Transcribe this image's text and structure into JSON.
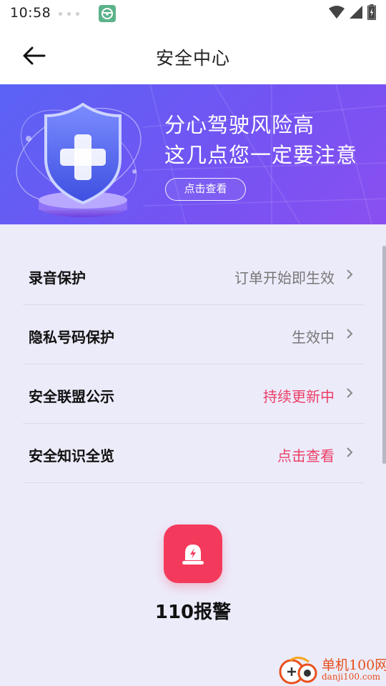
{
  "status_bar": {
    "time": "10:58",
    "icons": [
      "wifi-icon",
      "signal-icon",
      "battery-icon"
    ]
  },
  "header": {
    "title": "安全中心",
    "back_icon": "arrow-left-icon"
  },
  "banner": {
    "line1": "分心驾驶风险高",
    "line2": "这几点您一定要注意",
    "button_label": "点击查看",
    "colors": {
      "start": "#5a63f5",
      "end": "#8a4ff0"
    }
  },
  "list": {
    "items": [
      {
        "label": "录音保护",
        "value": "订单开始即生效",
        "accent": false
      },
      {
        "label": "隐私号码保护",
        "value": "生效中",
        "accent": false
      },
      {
        "label": "安全联盟公示",
        "value": "持续更新中",
        "accent": true
      },
      {
        "label": "安全知识全览",
        "value": "点击查看",
        "accent": true
      }
    ],
    "accent_color": "#ec3f67"
  },
  "alarm": {
    "label": "110报警",
    "icon": "siren-icon",
    "color": "#f43a5c"
  },
  "watermark": {
    "title": "单机100网",
    "url": "danji100.com"
  }
}
